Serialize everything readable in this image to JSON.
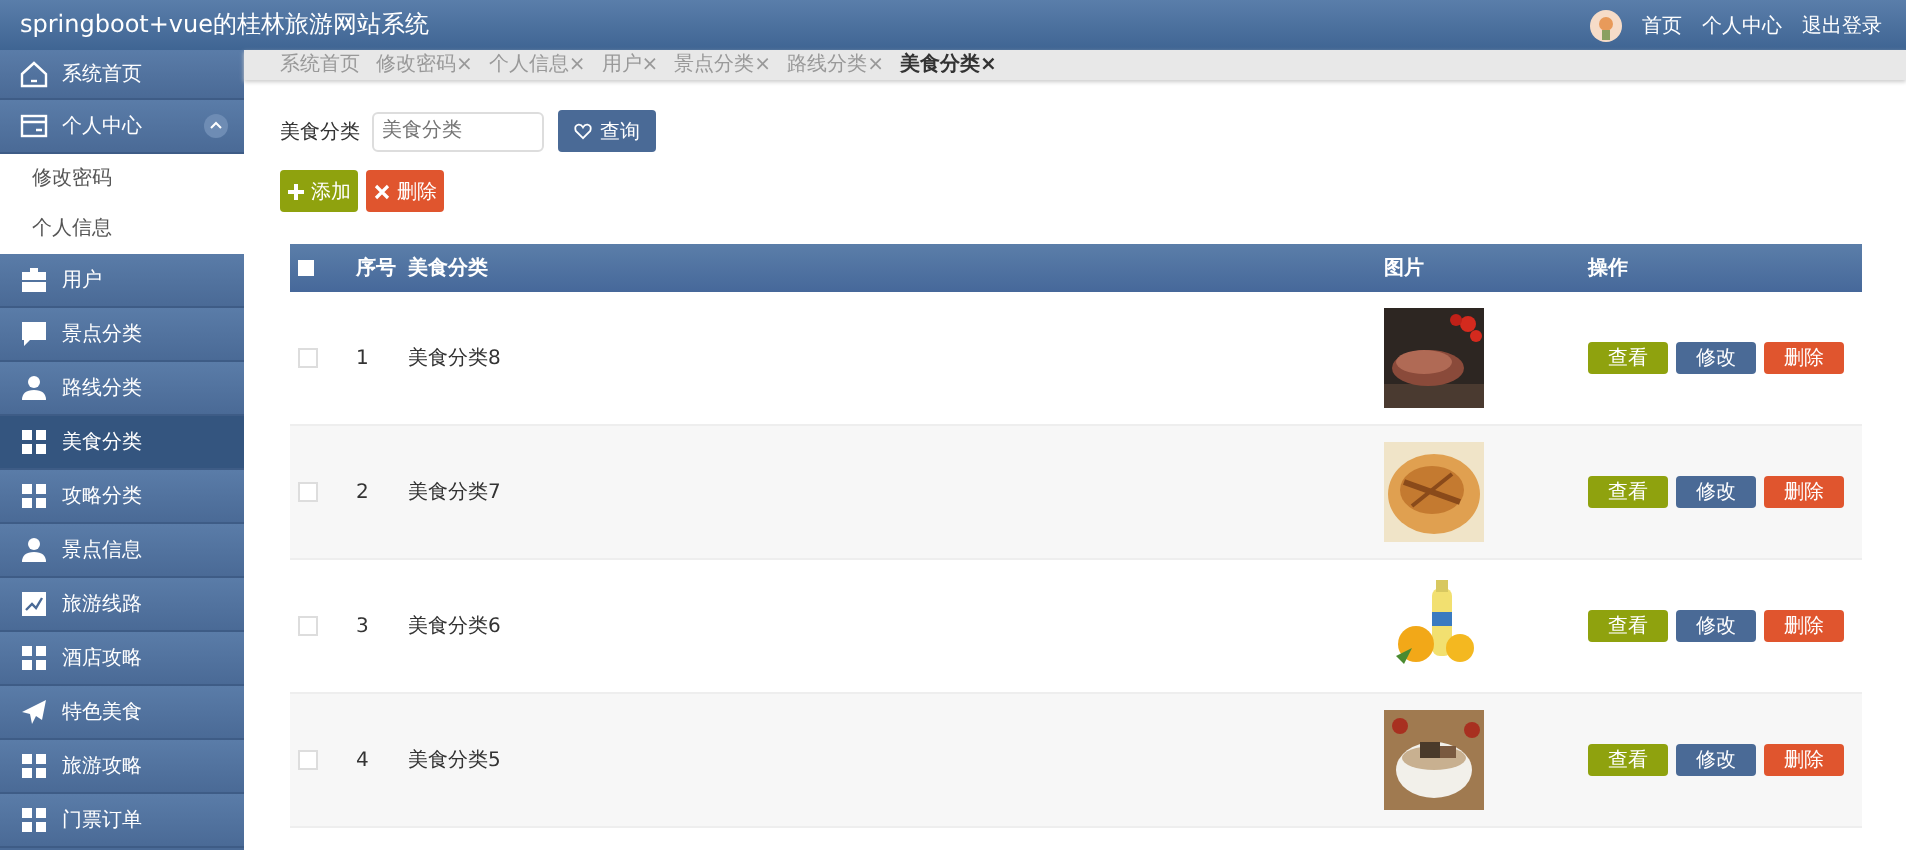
{
  "header": {
    "title": "springboot+vue的桂林旅游网站系统",
    "links": [
      "首页",
      "个人中心",
      "退出登录"
    ]
  },
  "sidebar": {
    "items": [
      {
        "label": "系统首页",
        "selected": false
      },
      {
        "label": "个人中心",
        "selected": false,
        "expanded": true,
        "children": [
          {
            "label": "修改密码"
          },
          {
            "label": "个人信息"
          }
        ]
      },
      {
        "label": "用户",
        "selected": false
      },
      {
        "label": "景点分类",
        "selected": false
      },
      {
        "label": "路线分类",
        "selected": false
      },
      {
        "label": "美食分类",
        "selected": true
      },
      {
        "label": "攻略分类",
        "selected": false
      },
      {
        "label": "景点信息",
        "selected": false
      },
      {
        "label": "旅游线路",
        "selected": false
      },
      {
        "label": "酒店攻略",
        "selected": false
      },
      {
        "label": "特色美食",
        "selected": false
      },
      {
        "label": "旅游攻略",
        "selected": false
      },
      {
        "label": "门票订单",
        "selected": false
      }
    ]
  },
  "tabs": [
    {
      "label": "系统首页",
      "closable": false,
      "selected": false
    },
    {
      "label": "修改密码",
      "closable": true,
      "selected": false
    },
    {
      "label": "个人信息",
      "closable": true,
      "selected": false
    },
    {
      "label": "用户",
      "closable": true,
      "selected": false
    },
    {
      "label": "景点分类",
      "closable": true,
      "selected": false
    },
    {
      "label": "路线分类",
      "closable": true,
      "selected": false
    },
    {
      "label": "美食分类",
      "closable": true,
      "selected": true
    }
  ],
  "tab_close": "×",
  "search": {
    "label": "美食分类",
    "placeholder": "美食分类",
    "button": "查询"
  },
  "actions": {
    "add": "添加",
    "delete": "删除"
  },
  "table": {
    "columns": [
      "序号",
      "美食分类",
      "图片",
      "操作"
    ],
    "rows": [
      {
        "index": "1",
        "name": "美食分类8",
        "checked": false,
        "buttons": [
          "查看",
          "修改",
          "删除"
        ]
      },
      {
        "index": "2",
        "name": "美食分类7",
        "checked": false,
        "buttons": [
          "查看",
          "修改",
          "删除"
        ]
      },
      {
        "index": "3",
        "name": "美食分类6",
        "checked": false,
        "buttons": [
          "查看",
          "修改",
          "删除"
        ]
      },
      {
        "index": "4",
        "name": "美食分类5",
        "checked": false,
        "buttons": [
          "查看",
          "修改",
          "删除"
        ]
      }
    ],
    "all_checked": false
  }
}
